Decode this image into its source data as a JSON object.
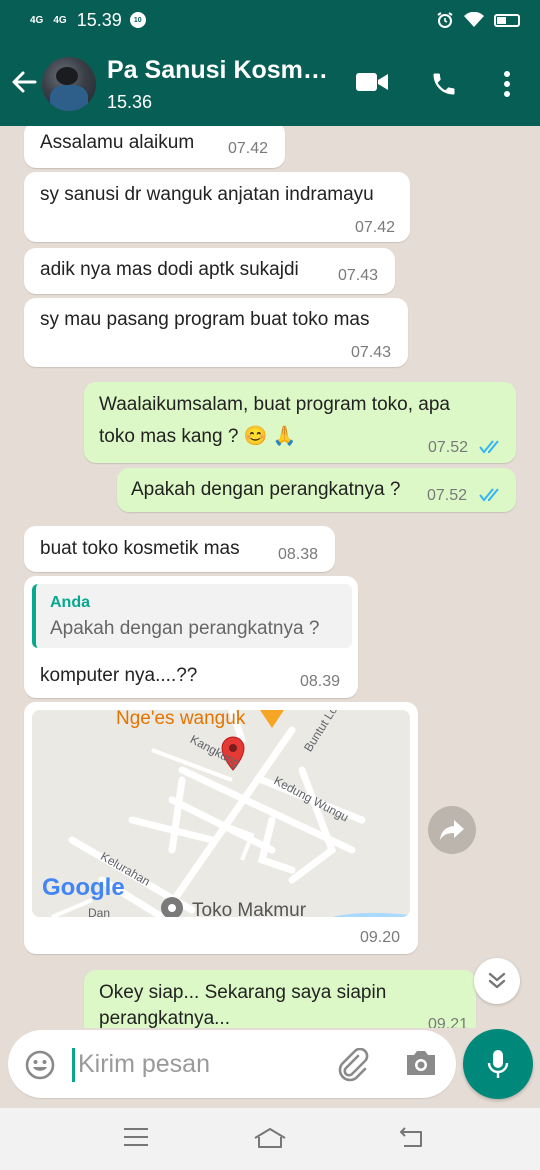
{
  "status_bar": {
    "network1": "4G",
    "network2": "4G",
    "time": "15.39",
    "badge": "10"
  },
  "header": {
    "contact_name": "Pa Sanusi Kosm…",
    "last_seen": "15.36"
  },
  "messages": [
    {
      "dir": "in",
      "text": "Assalamu alaikum",
      "time": "07.42"
    },
    {
      "dir": "in",
      "text": "sy sanusi dr wanguk anjatan indramayu",
      "time": "07.42"
    },
    {
      "dir": "in",
      "text": "adik nya mas dodi aptk sukajdi",
      "time": "07.43"
    },
    {
      "dir": "in",
      "text": "sy mau pasang program buat toko mas",
      "time": "07.43"
    },
    {
      "dir": "out",
      "line1": "Waalaikumsalam, buat program toko, apa",
      "line2": "toko mas kang ? 😊 🙏",
      "time": "07.52"
    },
    {
      "dir": "out",
      "text": "Apakah dengan perangkatnya ?",
      "time": "07.52"
    },
    {
      "dir": "in",
      "text": "buat toko kosmetik mas",
      "time": "08.38"
    },
    {
      "dir": "in",
      "quote_name": "Anda",
      "quote_text": "Apakah dengan perangkatnya ?",
      "text": "komputer nya....??",
      "time": "08.39"
    },
    {
      "dir": "in",
      "type": "location",
      "time": "09.20",
      "map_labels": {
        "place": "Nge'es wanguk",
        "road1": "Kangkung",
        "road2": "Buntut Lor",
        "road3": "Kedung Wungu",
        "road4": "Kelurahan",
        "road5": "Dan",
        "poi": "Toko Makmur",
        "provider": "Google"
      }
    },
    {
      "dir": "out",
      "line1": "Okey siap... Sekarang saya siapin",
      "line2": "perangkatnya...",
      "time": "09.21"
    }
  ],
  "composer": {
    "placeholder": "Kirim pesan"
  },
  "colors": {
    "header": "#075e54",
    "outgoing": "#dcf8c6",
    "incoming": "#ffffff",
    "chat_bg": "#e5ddd5",
    "accent": "#00897b",
    "ticks": "#34b7f1"
  },
  "icons": [
    "back-arrow-icon",
    "video-call-icon",
    "phone-icon",
    "more-vert-icon",
    "forward-icon",
    "scroll-down-icon",
    "emoji-icon",
    "attach-icon",
    "camera-icon",
    "mic-icon",
    "menu-icon",
    "home-icon",
    "back-icon"
  ]
}
